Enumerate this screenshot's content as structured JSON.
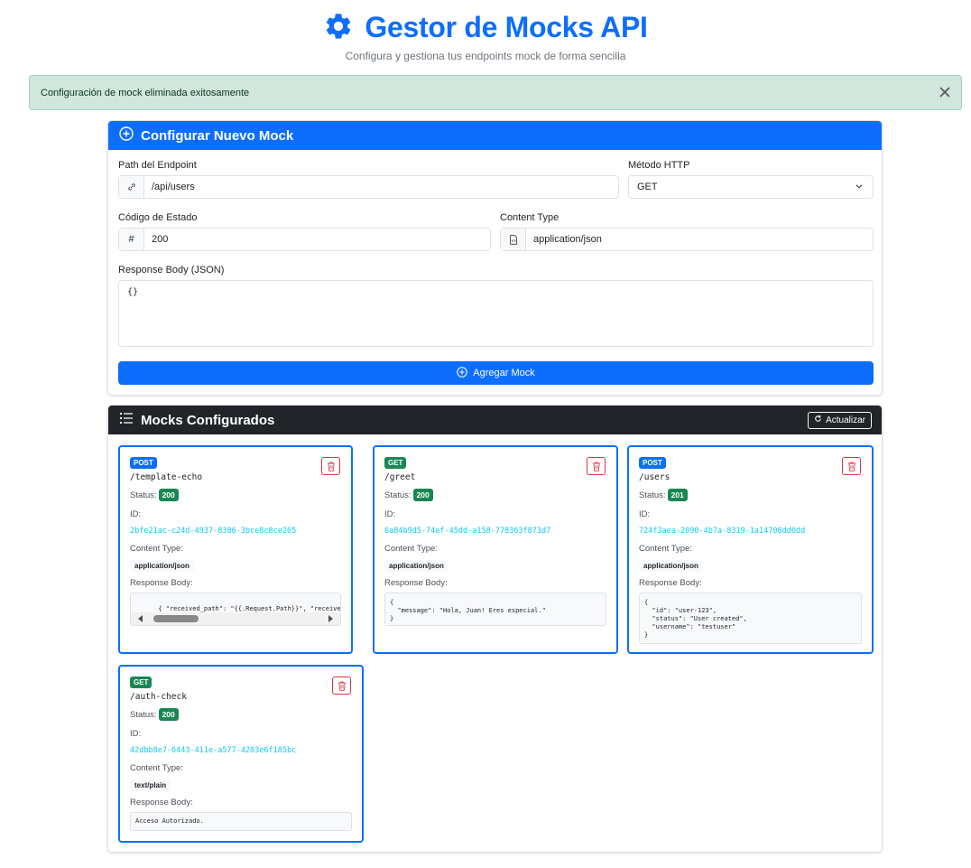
{
  "header": {
    "title": "Gestor de Mocks API",
    "subtitle": "Configura y gestiona tus endpoints mock de forma sencilla",
    "icon": "gear-icon"
  },
  "alert": {
    "message": "Configuración de mock eliminada exitosamente"
  },
  "form": {
    "title": "Configurar Nuevo Mock",
    "path_label": "Path del Endpoint",
    "path_value": "/api/users",
    "method_label": "Método HTTP",
    "method_value": "GET",
    "status_label": "Código de Estado",
    "status_addon": "#",
    "status_value": "200",
    "content_type_label": "Content Type",
    "content_type_value": "application/json",
    "body_label": "Response Body (JSON)",
    "body_value": "{}",
    "submit_label": "Agregar Mock"
  },
  "list": {
    "title": "Mocks Configurados",
    "refresh_label": "Actualizar",
    "status_label": "Status:",
    "id_label": "ID:",
    "content_type_label": "Content Type:",
    "body_label": "Response Body:",
    "mocks": [
      {
        "method": "POST",
        "path": "/template-echo",
        "status": "200",
        "id": "2bfe21ac-c24d-4937-8386-3bce8c8ce205",
        "content_type": "application/json",
        "body": "{ \"received_path\": \"{{.Request.Path}}\", \"received_method\":"
      },
      {
        "method": "GET",
        "path": "/greet",
        "status": "200",
        "id": "6a84b9d5-74ef-45dd-a158-778363f873d7",
        "content_type": "application/json",
        "body": "{\n  \"message\": \"Hola, Juan! Eres especial.\"\n}"
      },
      {
        "method": "POST",
        "path": "/users",
        "status": "201",
        "id": "724f3aea-2090-4b7a-8319-1a14708dd6dd",
        "content_type": "application/json",
        "body": "{\n  \"id\": \"user-123\",\n  \"status\": \"User created\",\n  \"username\": \"testuser\"\n}"
      },
      {
        "method": "GET",
        "path": "/auth-check",
        "status": "200",
        "id": "42dbb8e7-6443-411e-a577-4203e6f185bc",
        "content_type": "text/plain",
        "body": "Acceso Autorizado."
      }
    ]
  },
  "colors": {
    "primary": "#0d6efd",
    "post_badge": "#0d6efd",
    "get_badge": "#198754",
    "status_badge": "#198754",
    "danger": "#dc3545",
    "dark_header": "#212529",
    "alert_bg": "#d1e7dd",
    "id_text": "#0dcaf0"
  }
}
